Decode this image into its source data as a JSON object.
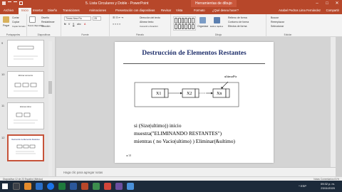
{
  "window": {
    "title": "5. Lista Circulares y Doble - PowerPoint",
    "contextual_tab": "Herramientas de dibujo",
    "minimize": "–",
    "maximize": "□",
    "close": "✕"
  },
  "tabs": [
    {
      "label": "Archivo"
    },
    {
      "label": "Inicio"
    },
    {
      "label": "Insertar"
    },
    {
      "label": "Diseño"
    },
    {
      "label": "Transiciones"
    },
    {
      "label": "Animaciones"
    },
    {
      "label": "Presentación con diapositivas"
    },
    {
      "label": "Revisar"
    },
    {
      "label": "Vista"
    },
    {
      "label": "Formato"
    },
    {
      "label": "¿Qué desea hacer?"
    }
  ],
  "user": "Anabel Pedros Lima Fernández",
  "share": "Compartir",
  "ribbon": {
    "clipboard": {
      "label": "Portapapeles",
      "paste": "Pegar",
      "cut": "Cortar",
      "copy": "Copiar",
      "format": "Copiar formato"
    },
    "slides": {
      "label": "Diapositivas",
      "new": "Nueva diapositiva",
      "layout": "Diseño",
      "reset": "Restablecer",
      "section": "Sección"
    },
    "font": {
      "label": "Fuente",
      "name": "Times New Ro",
      "size": "28"
    },
    "paragraph": {
      "label": "Párrafo",
      "direction": "Dirección del texto",
      "align": "Alinear texto",
      "smartart": "Convertir a SmartArt"
    },
    "drawing": {
      "label": "Dibujo",
      "arrange": "Organizar",
      "quickstyles": "Estilos rápidos",
      "fill": "Relleno de forma",
      "outline": "Contorno de forma",
      "effects": "Efectos de forma"
    },
    "editing": {
      "label": "Edición",
      "find": "Buscar",
      "replace": "Reemplazar",
      "select": "Seleccionar"
    }
  },
  "thumbnails": [
    {
      "num": "9",
      "title": "",
      "selected": false
    },
    {
      "num": "10",
      "title": "Eliminar elementos",
      "selected": false
    },
    {
      "num": "11",
      "title": "Eliminar último",
      "selected": false
    },
    {
      "num": "12",
      "title": "Destrucción de Elementos Restantes",
      "selected": true
    }
  ],
  "slide": {
    "title": "Destrucción de Elementos Restantes",
    "pointer_label": "ultimoPtr",
    "nodes": [
      "X1",
      "X2",
      "Xn"
    ],
    "code": [
      "si (Size(ultimo)) inicio",
      "muestra(\"ELIMINANDO RESTANTES\")",
      "mientras ( no Vacio(ultimo) ) Eliminar(&ultimo)"
    ],
    "page_number": "10"
  },
  "notes_placeholder": "Haga clic para agregar notas",
  "status": {
    "left": "Diapositiva 12 de 23   Español (México)",
    "right": "Notas   Comentarios                      61%"
  },
  "taskbar": {
    "tray": "^  ESP",
    "time": "09:32 p. m.",
    "date": "23/11/2020"
  },
  "colors": {
    "accent": "#b7472a",
    "title_text": "#1f2f6b"
  }
}
